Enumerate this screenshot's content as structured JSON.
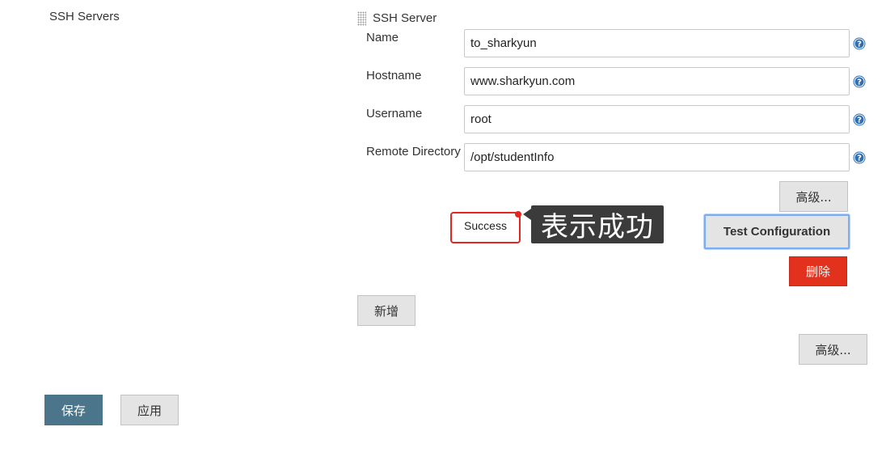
{
  "section": {
    "label": "SSH Servers"
  },
  "server": {
    "title": "SSH Server",
    "fields": [
      {
        "label": "Name",
        "value": "to_sharkyun"
      },
      {
        "label": "Hostname",
        "value": "www.sharkyun.com"
      },
      {
        "label": "Username",
        "value": "root"
      },
      {
        "label": "Remote Directory",
        "value": "/opt/studentInfo"
      }
    ],
    "advanced_label": "高级...",
    "status_text": "Success",
    "annotation_text": "表示成功",
    "test_label": "Test Configuration",
    "delete_label": "删除"
  },
  "add_label": "新增",
  "advanced_label": "高级...",
  "footer": {
    "save_label": "保存",
    "apply_label": "应用"
  },
  "colors": {
    "primary": "#4b758b",
    "danger": "#e2321d",
    "help": "#2f6fb3",
    "annotation_border": "#e5261e",
    "focus": "#7aaef0"
  },
  "icons": {
    "help": "help-icon",
    "drag": "drag-handle-icon"
  }
}
